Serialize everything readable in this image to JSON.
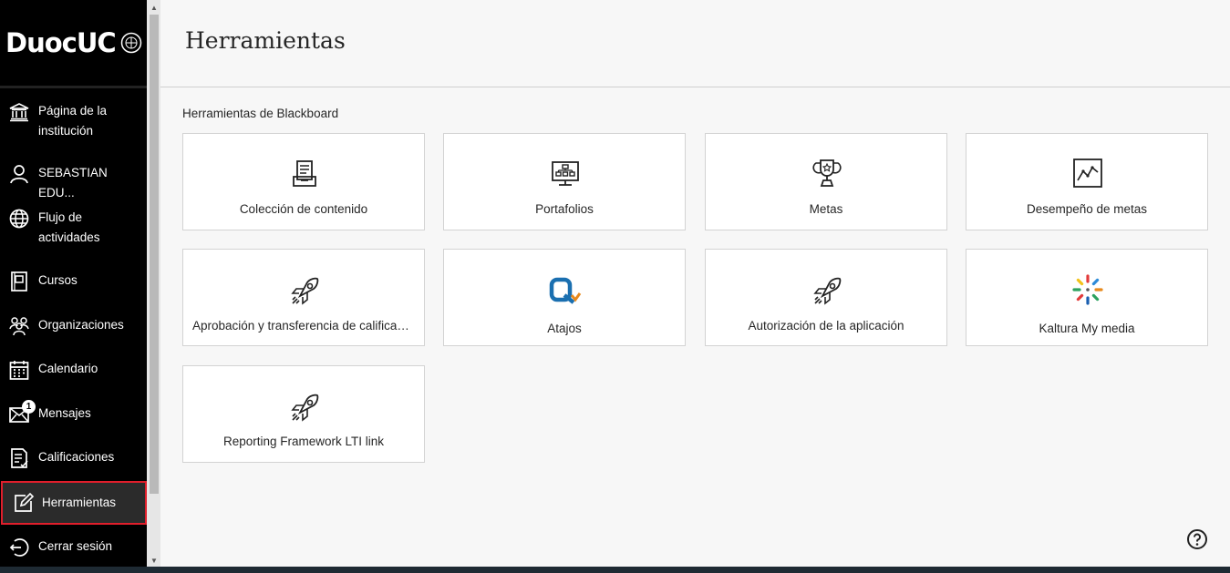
{
  "brand": {
    "logo_text": "DuocUC"
  },
  "sidebar": {
    "items": [
      {
        "label_line1": "Página de la",
        "label_line2": "institución",
        "icon": "institution-icon"
      },
      {
        "label": "SEBASTIAN EDU...",
        "icon": "user-icon"
      },
      {
        "label_line1": "Flujo de",
        "label_line2": "actividades",
        "icon": "globe-icon"
      },
      {
        "label": "Cursos",
        "icon": "courses-icon"
      },
      {
        "label": "Organizaciones",
        "icon": "organizations-icon"
      },
      {
        "label": "Calendario",
        "icon": "calendar-icon"
      },
      {
        "label": "Mensajes",
        "icon": "mail-icon",
        "badge": "1"
      },
      {
        "label": "Calificaciones",
        "icon": "grades-icon"
      },
      {
        "label": "Herramientas",
        "icon": "tools-edit-icon",
        "active": true
      },
      {
        "label": "Cerrar sesión",
        "icon": "logout-icon"
      }
    ]
  },
  "main": {
    "title": "Herramientas",
    "section_title": "Herramientas de Blackboard",
    "tools": [
      {
        "label": "Colección de contenido",
        "icon": "content-collection-icon"
      },
      {
        "label": "Portafolios",
        "icon": "portfolio-icon"
      },
      {
        "label": "Metas",
        "icon": "trophy-icon"
      },
      {
        "label": "Desempeño de metas",
        "icon": "goal-performance-icon"
      },
      {
        "label": "Aprobación y transferencia de calificaci...",
        "icon": "rocket-icon"
      },
      {
        "label": "Atajos",
        "icon": "atajos-icon"
      },
      {
        "label": "Autorización de la aplicación",
        "icon": "rocket-icon"
      },
      {
        "label": "Kaltura My media",
        "icon": "kaltura-icon"
      },
      {
        "label": "Reporting Framework LTI link",
        "icon": "rocket-icon"
      }
    ]
  },
  "colors": {
    "sidebar_bg": "#000000",
    "active_border": "#e01e2b",
    "kaltura_orange": "#e8891c",
    "atajos_blue": "#1a6fb0"
  }
}
